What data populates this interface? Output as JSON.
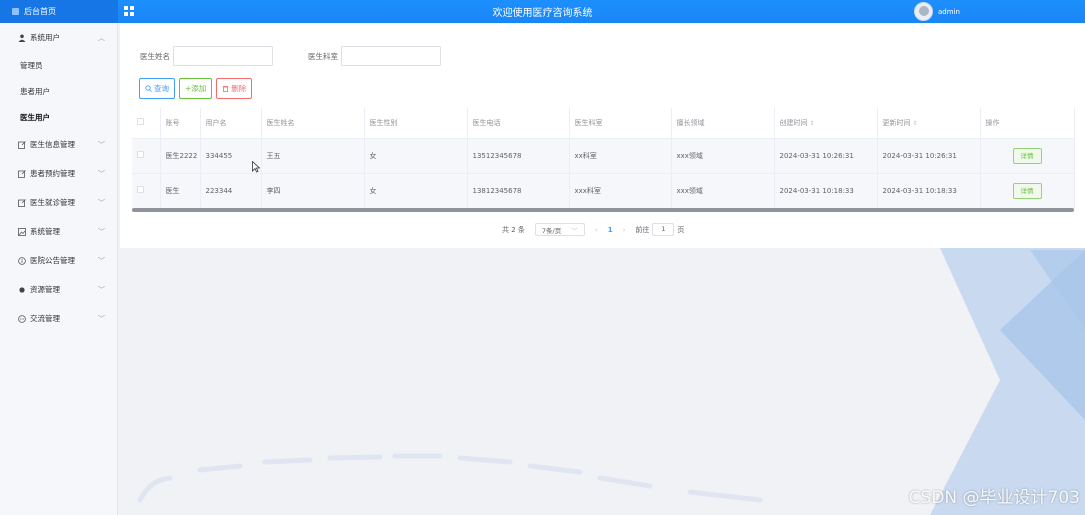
{
  "header": {
    "home_label": "后台首页",
    "site_title": "欢迎使用医疗咨询系统",
    "username": "admin"
  },
  "sidebar": {
    "items": [
      {
        "label": "系统用户",
        "icon": "user-icon",
        "expanded": true,
        "children": [
          "管理员",
          "患者用户",
          "医生用户"
        ]
      },
      {
        "label": "医生信息管理",
        "icon": "edit-icon"
      },
      {
        "label": "患者预约管理",
        "icon": "edit-icon"
      },
      {
        "label": "医生就诊管理",
        "icon": "edit-icon"
      },
      {
        "label": "系统管理",
        "icon": "image-icon"
      },
      {
        "label": "医院公告管理",
        "icon": "info-icon"
      },
      {
        "label": "资源管理",
        "icon": "dot-icon"
      },
      {
        "label": "交流管理",
        "icon": "chat-icon"
      }
    ]
  },
  "search": {
    "doctor_name_label": "医生姓名",
    "doctor_dept_label": "医生科室"
  },
  "toolbar": {
    "query_label": "查询",
    "add_label": "+添加",
    "delete_label": "删除"
  },
  "table": {
    "headers": [
      "账号",
      "用户名",
      "医生姓名",
      "医生性别",
      "医生电话",
      "医生科室",
      "擅长领域",
      "创建时间",
      "更新时间",
      "操作"
    ],
    "rows": [
      {
        "account": "医生2222",
        "username": "334455",
        "name": "王五",
        "gender": "女",
        "phone": "13512345678",
        "dept": "xx科室",
        "field": "xxx领域",
        "created": "2024-03-31 10:26:31",
        "updated": "2024-03-31 10:26:31",
        "action": "详情"
      },
      {
        "account": "医生",
        "username": "223344",
        "name": "李四",
        "gender": "女",
        "phone": "13812345678",
        "dept": "xxx科室",
        "field": "xxx领域",
        "created": "2024-03-31 10:18:33",
        "updated": "2024-03-31 10:18:33",
        "action": "详情"
      }
    ]
  },
  "pager": {
    "total": "共 2 条",
    "page_size": "7条/页",
    "current": "1",
    "goto_prefix": "前往",
    "goto_value": "1",
    "goto_suffix": "页"
  },
  "watermark": "CSDN @毕业设计703",
  "colors": {
    "primary": "#1e90ff",
    "success": "#67c23a",
    "danger": "#f56c6c"
  }
}
